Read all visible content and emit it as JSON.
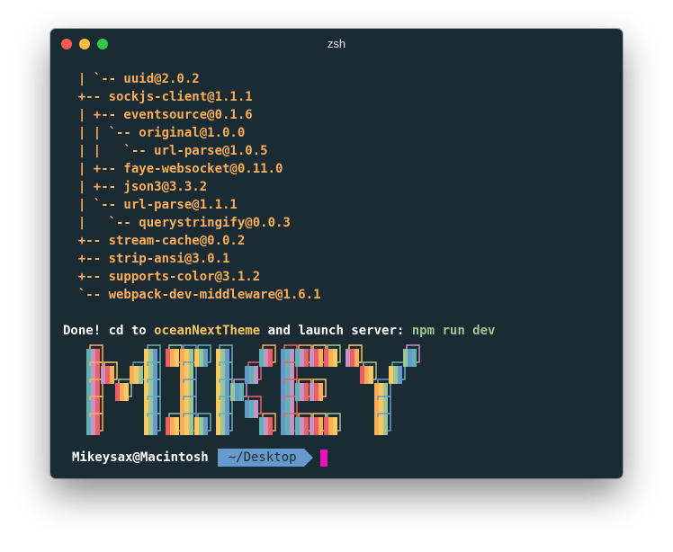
{
  "window": {
    "title": "zsh"
  },
  "tree": [
    "  | `-- uuid@2.0.2",
    "  +-- sockjs-client@1.1.1",
    "  | +-- eventsource@0.1.6",
    "  | | `-- original@1.0.0",
    "  | |   `-- url-parse@1.0.5",
    "  | +-- faye-websocket@0.11.0",
    "  | +-- json3@3.3.2",
    "  | `-- url-parse@1.1.1",
    "  |   `-- querystringify@0.0.3",
    "  +-- stream-cache@0.0.2",
    "  +-- strip-ansi@3.0.1",
    "  +-- supports-color@3.1.2",
    "  `-- webpack-dev-middleware@1.6.1"
  ],
  "done": {
    "prefix": "Done! cd to ",
    "project": "oceanNextTheme",
    "middle": " and launch server: ",
    "command": "npm run dev"
  },
  "banner": {
    "text": "MIKEY",
    "colors": [
      "#5fb3b3",
      "#c594c5",
      "#ec5f67",
      "#f9ae58",
      "#fac863",
      "#99c794",
      "#6699cc"
    ]
  },
  "prompt": {
    "user": "Mikeysax@Macintosh",
    "cwd": "~/Desktop"
  }
}
